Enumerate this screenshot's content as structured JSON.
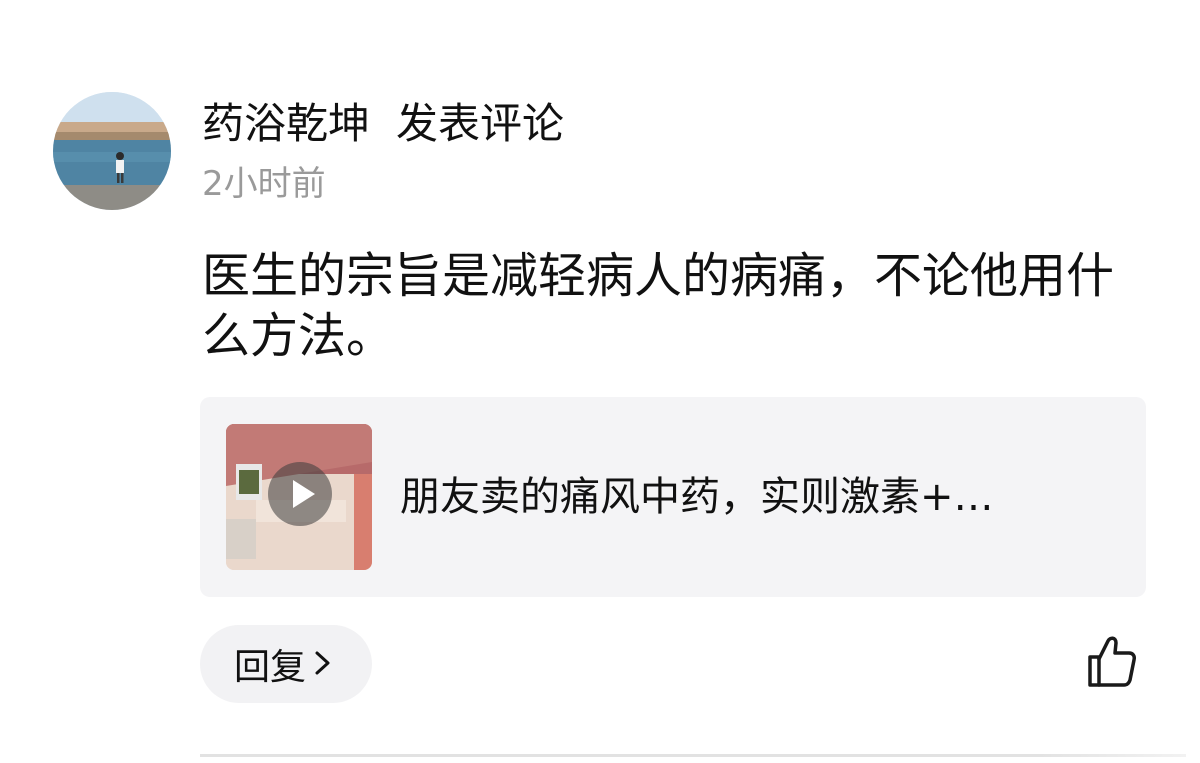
{
  "comment": {
    "author": "药浴乾坤",
    "action": "发表评论",
    "time": "2小时前",
    "text": "医生的宗旨是减轻病人的病痛，不论他用什么方法。"
  },
  "link_card": {
    "title": "朋友卖的痛风中药，实则激素+…",
    "thumbnail_icon": "video-thumbnail",
    "play_icon": "play-icon"
  },
  "actions": {
    "reply_label": "回复",
    "reply_icon": "chevron-right-icon",
    "like_icon": "thumbs-up-icon"
  },
  "colors": {
    "text": "#111111",
    "muted": "#9a9a9a",
    "card_bg": "#f4f4f6",
    "pill_bg": "#f2f2f4"
  }
}
